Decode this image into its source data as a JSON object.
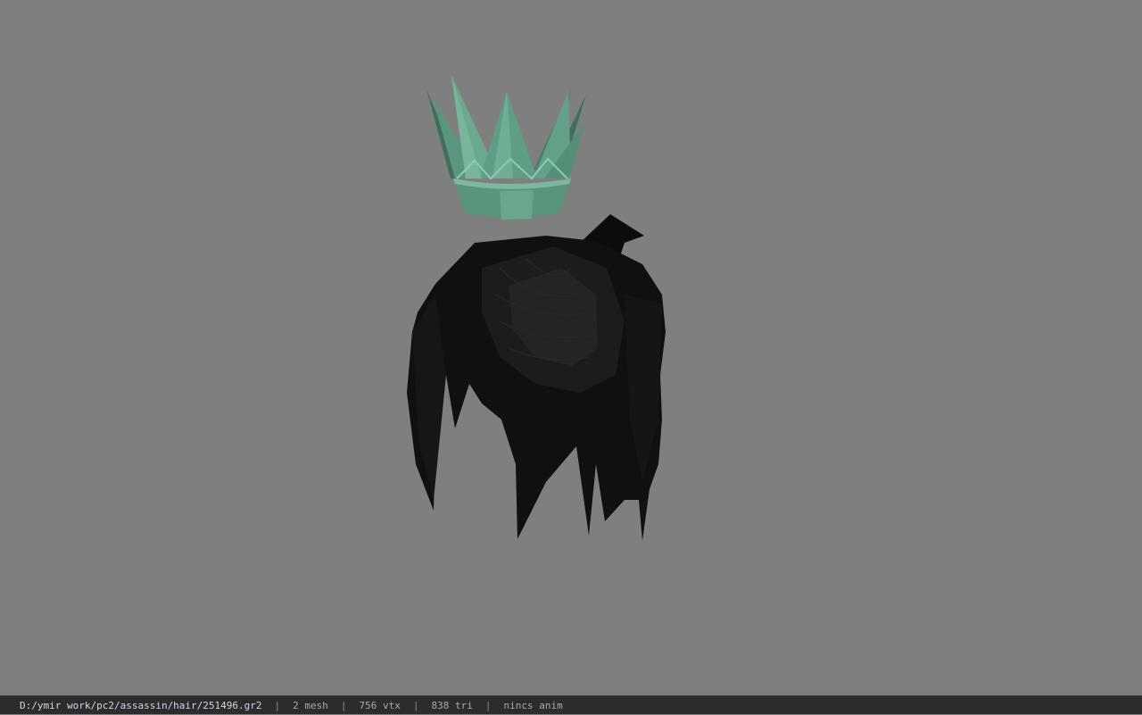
{
  "status_bar": {
    "file_path": "D:/ymir work/pc2/assassin/hair/251496.gr2",
    "separator": "|",
    "mesh_count": "2 mesh",
    "vertex_count": "756 vtx",
    "triangle_count": "838 tri",
    "animation": "nincs anim"
  },
  "viewport": {
    "background_color": "#7f7f7f",
    "model_parts": [
      "crown-model",
      "hair-model"
    ],
    "crown_color": "#5e9a83",
    "hair_color": "#111111"
  }
}
